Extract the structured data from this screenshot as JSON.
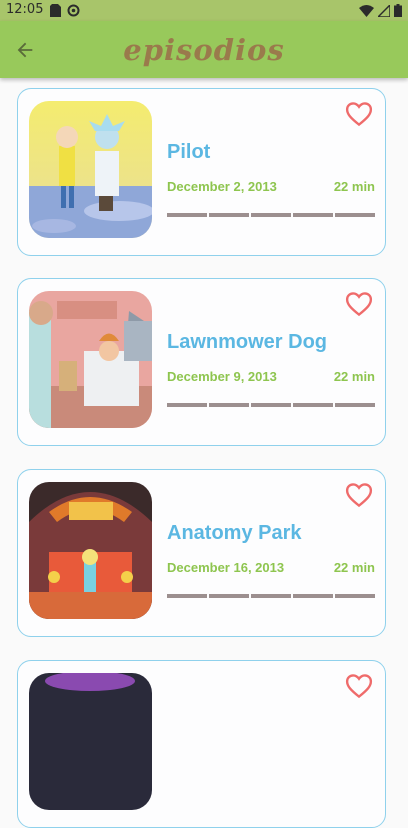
{
  "status_bar": {
    "time": "12:05"
  },
  "app_bar": {
    "title": "episodios",
    "back_icon": "arrow-back-icon"
  },
  "colors": {
    "app_bar": "#98c95b",
    "title": "#9a7a4c",
    "episode_title": "#5bb7e2",
    "meta": "#8ec54f",
    "card_border": "#8fd1ec",
    "heart": "#ef6b6b",
    "rating_bar": "#9c8f8f"
  },
  "episodes": [
    {
      "title": "Pilot",
      "date": "December 2, 2013",
      "duration": "22 min",
      "favorite_icon": "heart-outline-icon",
      "rating_segments": 5
    },
    {
      "title": "Lawnmower Dog",
      "date": "December 9, 2013",
      "duration": "22 min",
      "favorite_icon": "heart-outline-icon",
      "rating_segments": 5
    },
    {
      "title": "Anatomy Park",
      "date": "December 16, 2013",
      "duration": "22 min",
      "favorite_icon": "heart-outline-icon",
      "rating_segments": 5
    }
  ]
}
